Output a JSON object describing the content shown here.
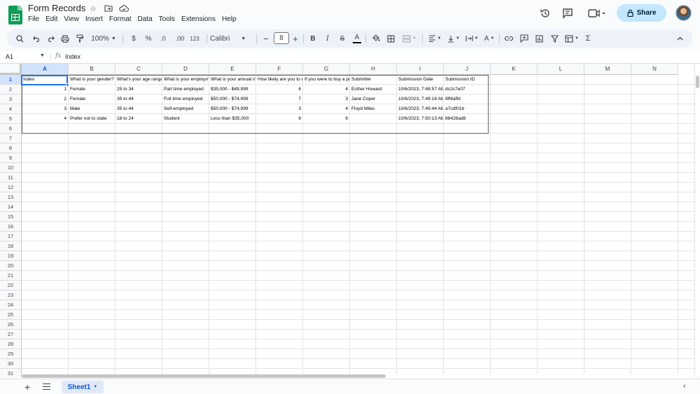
{
  "app": {
    "doc_title": "Form Records",
    "menu": [
      "File",
      "Edit",
      "View",
      "Insert",
      "Format",
      "Data",
      "Tools",
      "Extensions",
      "Help"
    ],
    "share_label": "Share"
  },
  "toolbar": {
    "zoom": "100%",
    "currency": "$",
    "percent": "%",
    "dec_decrease": ".0",
    "dec_increase": ".00",
    "number_format": "123",
    "font": "Calibri",
    "font_size": "8",
    "bold": "B",
    "italic": "I",
    "strikethrough": "S",
    "text_color": "A",
    "sigma": "Σ"
  },
  "formula": {
    "name_box": "A1",
    "fx": "fx",
    "value": "Index"
  },
  "columns": [
    "A",
    "B",
    "C",
    "D",
    "E",
    "F",
    "G",
    "H",
    "I",
    "J",
    "K",
    "L",
    "M",
    "N"
  ],
  "rows": [
    "1",
    "2",
    "3",
    "4",
    "5",
    "6",
    "7",
    "8",
    "9",
    "10",
    "11",
    "12",
    "13",
    "14",
    "15",
    "16",
    "17",
    "18",
    "19",
    "20",
    "21",
    "22",
    "23",
    "24",
    "25",
    "26",
    "27",
    "28",
    "29",
    "30",
    "31"
  ],
  "table": {
    "header": [
      "Index",
      "What is your gender?",
      "What's your age range",
      "What is your employm",
      "What is your annual in",
      "How likely are you to r",
      "If you were to buy a pr",
      "Submitter",
      "Submission Date",
      "Submission ID"
    ],
    "rows": [
      [
        "1",
        "Female",
        "25 to 34",
        "Part time employed",
        "$35,000 - $49,999",
        "6",
        "4",
        "Esther Howard",
        "10/6/2023, 7:48:57 AM",
        "dc2c7e07"
      ],
      [
        "2",
        "Female",
        "35 to 44",
        "Full time employed",
        "$50,000 - $74,999",
        "7",
        "3",
        "Jane Coper",
        "10/6/2023, 7:49:18 AM",
        "9ff4affd"
      ],
      [
        "3",
        "Male",
        "35 to 44",
        "Self-employed",
        "$50,000 - $74,999",
        "3",
        "4",
        "Floyd Miles",
        "10/6/2023, 7:49:44 AM",
        "a7cdf01b"
      ],
      [
        "4",
        "Prefer not to state",
        "18 to 24",
        "Student",
        "Less than $35,000",
        "8",
        "6",
        "",
        "10/6/2023, 7:50:13 AM",
        "88428ad8"
      ]
    ]
  },
  "sheets": [
    {
      "name": "Sheet1",
      "active": true
    }
  ],
  "icons": {
    "title": [
      "star-icon",
      "move-to-folder-icon",
      "cloud-status-icon"
    ],
    "right": [
      "version-history-icon",
      "comments-icon",
      "meet-icon",
      "lock-icon"
    ]
  }
}
